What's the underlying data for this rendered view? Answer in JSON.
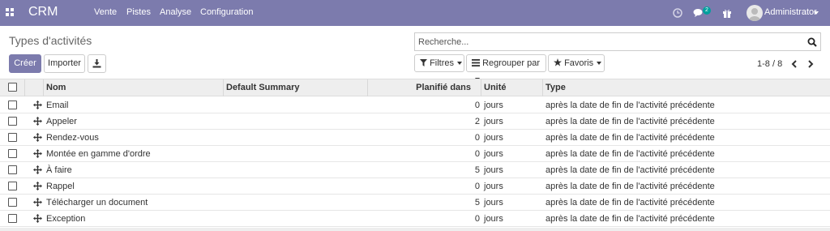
{
  "navbar": {
    "brand": "CRM",
    "menu": [
      "Vente",
      "Pistes",
      "Analyse",
      "Configuration"
    ],
    "messages_count": "2",
    "user": "Administrator"
  },
  "control": {
    "title": "Types d'activités",
    "create_label": "Créer",
    "import_label": "Importer",
    "search_placeholder": "Recherche...",
    "filters_label": "Filtres",
    "group_label": "Regrouper par",
    "favorites_label": "Favoris",
    "pager": "1-8 / 8"
  },
  "table": {
    "columns": {
      "name": "Nom",
      "summary": "Default Summary",
      "planned": "Planifié dans",
      "unit": "Unité",
      "type": "Type"
    },
    "rows": [
      {
        "name": "Email",
        "summary": "",
        "planned": "0",
        "unit": "jours",
        "type": "après la date de fin de l'activité précédente"
      },
      {
        "name": "Appeler",
        "summary": "",
        "planned": "2",
        "unit": "jours",
        "type": "après la date de fin de l'activité précédente"
      },
      {
        "name": "Rendez-vous",
        "summary": "",
        "planned": "0",
        "unit": "jours",
        "type": "après la date de fin de l'activité précédente"
      },
      {
        "name": "Montée en gamme d'ordre",
        "summary": "",
        "planned": "0",
        "unit": "jours",
        "type": "après la date de fin de l'activité précédente"
      },
      {
        "name": "À faire",
        "summary": "",
        "planned": "5",
        "unit": "jours",
        "type": "après la date de fin de l'activité précédente"
      },
      {
        "name": "Rappel",
        "summary": "",
        "planned": "0",
        "unit": "jours",
        "type": "après la date de fin de l'activité précédente"
      },
      {
        "name": "Télécharger un document",
        "summary": "",
        "planned": "5",
        "unit": "jours",
        "type": "après la date de fin de l'activité précédente"
      },
      {
        "name": "Exception",
        "summary": "",
        "planned": "0",
        "unit": "jours",
        "type": "après la date de fin de l'activité précédente"
      }
    ]
  },
  "colors": {
    "brand": "#7c7bad",
    "badge": "#00a09d"
  },
  "icons": {
    "apps": "apps-grid-icon",
    "clock": "clock-icon",
    "chat": "chat-icon",
    "gift": "gift-icon",
    "search": "search-icon",
    "download": "download-icon",
    "filter": "filter-icon",
    "group": "list-icon",
    "favorite": "star-icon",
    "drag": "drag-handle-icon"
  }
}
